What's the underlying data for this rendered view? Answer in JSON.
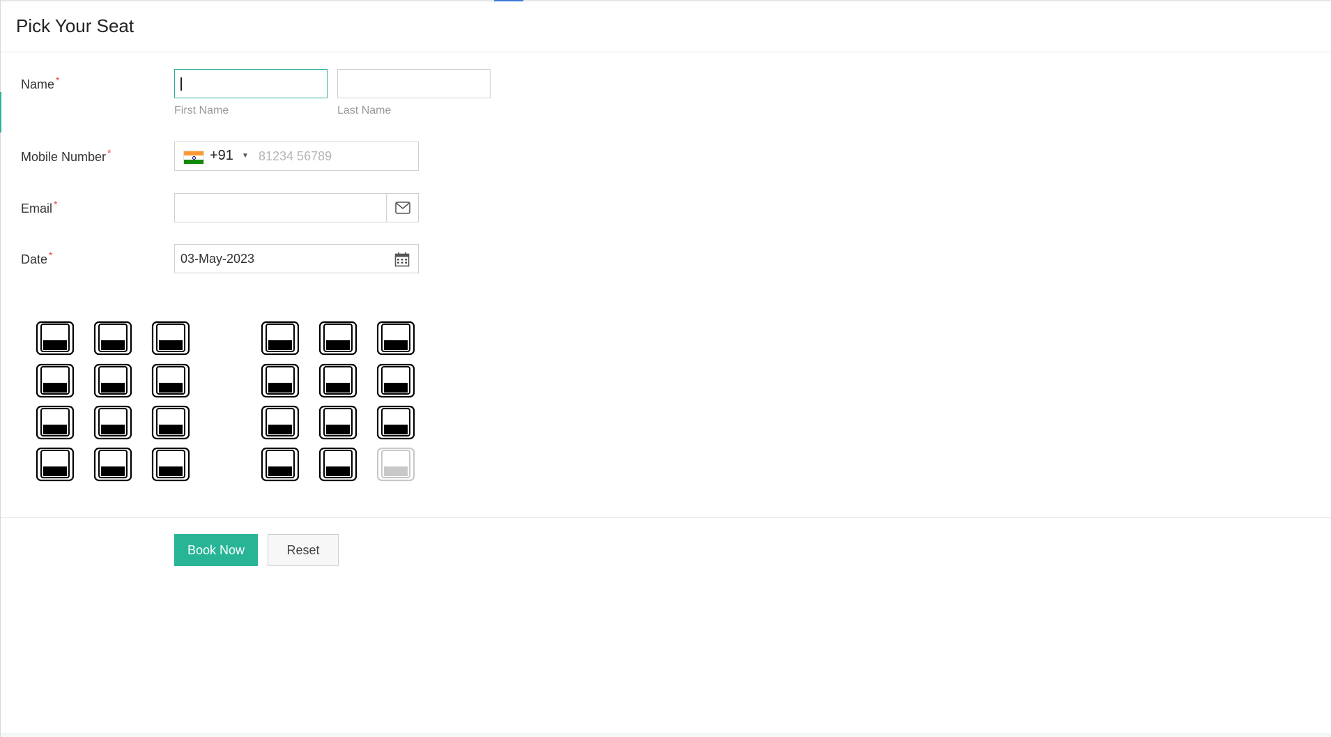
{
  "page": {
    "title": "Pick Your Seat"
  },
  "form": {
    "required_mark": "*",
    "name": {
      "label": "Name",
      "first_name_value": "",
      "first_name_caption": "First Name",
      "last_name_value": "",
      "last_name_caption": "Last Name"
    },
    "mobile": {
      "label": "Mobile Number",
      "country_flag_icon": "india-flag-icon",
      "dial_code": "+91",
      "placeholder": "81234 56789"
    },
    "email": {
      "label": "Email",
      "value": "",
      "icon": "envelope-icon"
    },
    "date": {
      "label": "Date",
      "value": "03-May-2023",
      "icon": "calendar-icon"
    }
  },
  "seats": {
    "rows": 4,
    "columns_per_block": 3,
    "blocks": 2,
    "available_color": "#000000",
    "disabled_color": "#c8c8c8",
    "seat_states": [
      [
        "available",
        "available",
        "available",
        "available",
        "available",
        "available"
      ],
      [
        "available",
        "available",
        "available",
        "available",
        "available",
        "available"
      ],
      [
        "available",
        "available",
        "available",
        "available",
        "available",
        "available"
      ],
      [
        "available",
        "available",
        "available",
        "available",
        "available",
        "disabled"
      ]
    ]
  },
  "actions": {
    "book_label": "Book Now",
    "reset_label": "Reset"
  },
  "colors": {
    "accent": "#27b596",
    "focus_border": "#2ab09b",
    "required": "#e04a4a"
  }
}
